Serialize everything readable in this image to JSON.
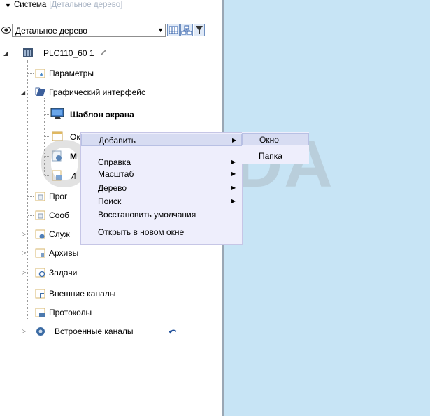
{
  "header": {
    "title": "Система",
    "hint": "[Детальное дерево]"
  },
  "view": {
    "selected": "Детальное дерево"
  },
  "tree": {
    "root": "PLC110_60 1",
    "params": "Параметры",
    "gui": "Графический интерфейс",
    "screen_template": "Шаблон экрана",
    "windows_partial": "Окн",
    "item_m": "М",
    "item_i": "И",
    "item_prog": "Прог",
    "item_soob": "Сооб",
    "item_sluzh": "Служ",
    "archives": "Архивы",
    "tasks": "Задачи",
    "external": "Внешние каналы",
    "protocols": "Протоколы",
    "builtin": "Встроенные каналы"
  },
  "context_menu": {
    "add": "Добавить",
    "help": "Справка",
    "scale": "Масштаб",
    "tree": "Дерево",
    "search": "Поиск",
    "restore": "Восстановить умолчания",
    "open_new": "Открыть в новом окне"
  },
  "submenu": {
    "window": "Окно",
    "folder": "Папка"
  },
  "watermark": "OLUNDA",
  "colors": {
    "right_panel": "#c7e4f5",
    "menu_bg": "#eeeefc",
    "menu_highlight": "#d7dcf2"
  }
}
